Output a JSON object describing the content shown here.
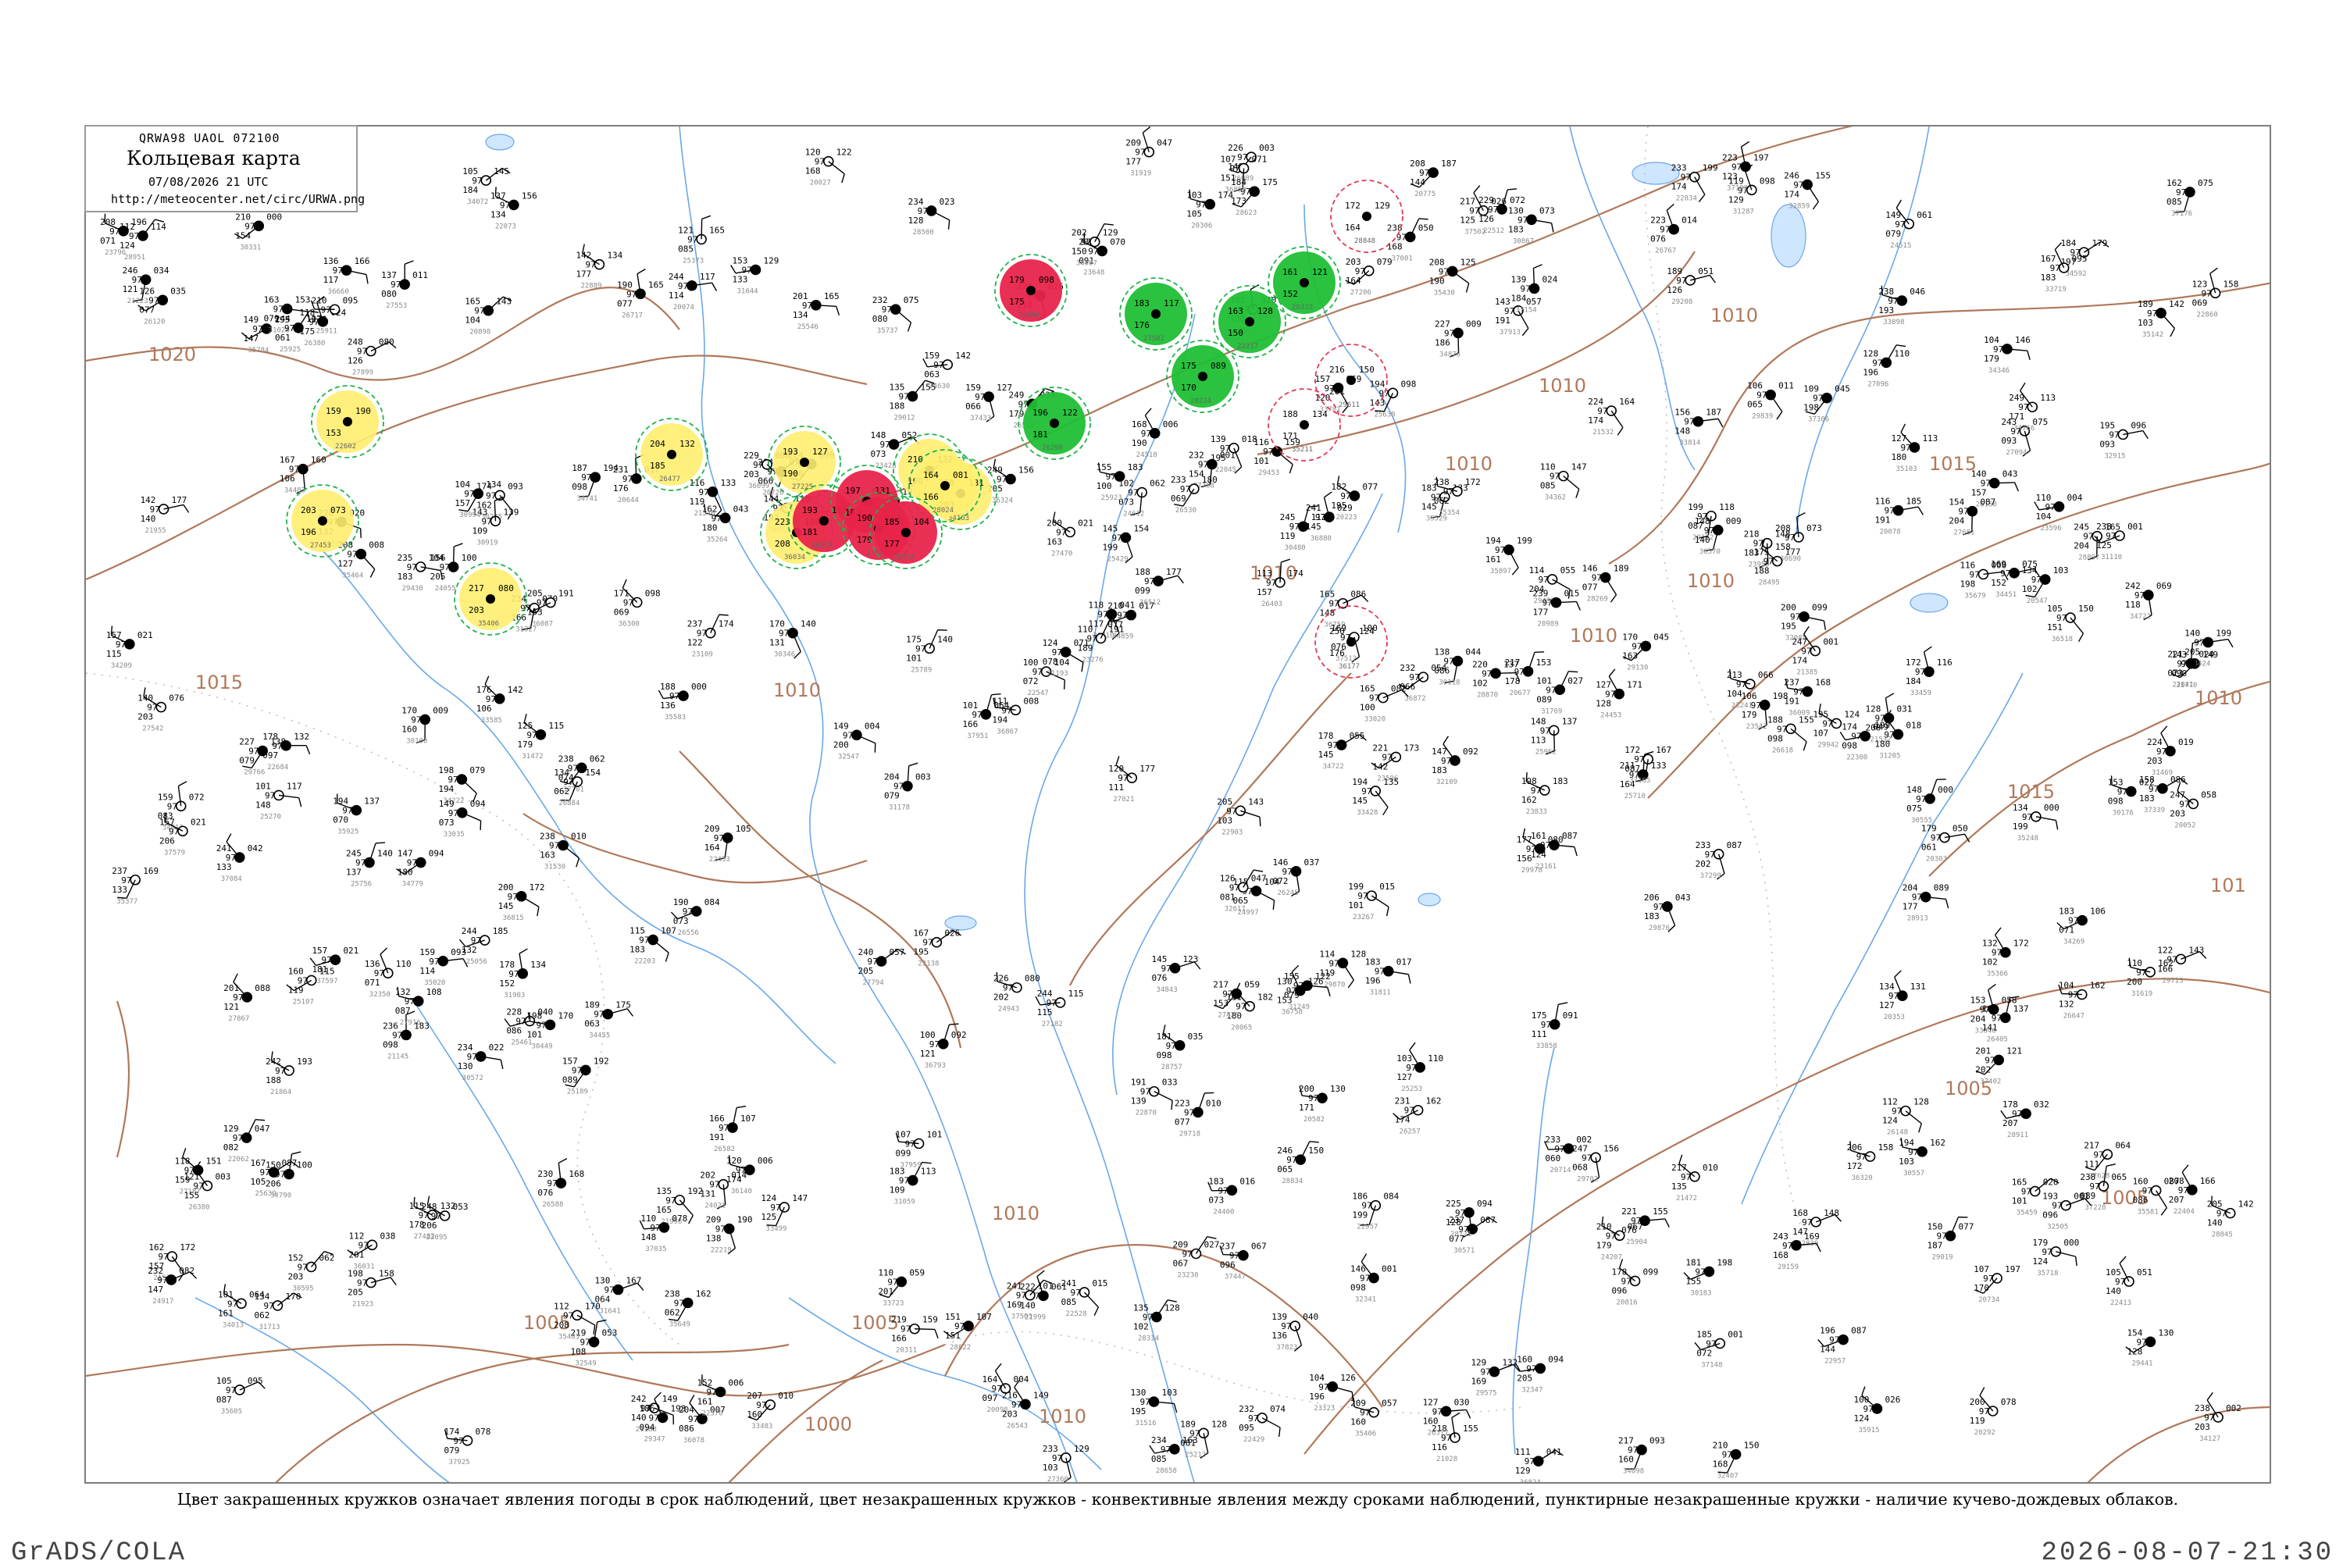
{
  "header": {
    "code": "QRWA98  UAOL  072100",
    "title": "Кольцевая карта",
    "date": "07/08/2026 21 UTC",
    "url": "http://meteocenter.net/circ/URWA.png"
  },
  "caption": "Цвет закрашенных кружков означает явления погоды в срок наблюдений, цвет незакрашенных кружков - конвективные явления между сроками наблюдений, пунктирные незакрашенные кружки - наличие кучево-дождевых облаков.",
  "footer": {
    "left": "GrADS/COLA",
    "right": "2026-08-07-21:30"
  },
  "colors": {
    "isobar": "#b0785a",
    "river": "#6aa8e8",
    "thunderstorm": "#e8244a",
    "shower": "#1fbf34",
    "drizzle_fog": "#ffee70",
    "cb_ring": "#21b34a",
    "convective_ring": "#e23a55"
  },
  "isobar_labels": [
    "1020",
    "1015",
    "1010",
    "1010",
    "1010",
    "1010",
    "1010",
    "1010",
    "1010",
    "1015",
    "1015",
    "1010",
    "1005",
    "1005",
    "1005",
    "1000",
    "1010",
    "1010",
    "1005",
    "101"
  ],
  "stations": [
    {
      "id": "22602",
      "t": "159",
      "p": "190",
      "d": "153",
      "fill": "drizzle_fog"
    },
    {
      "id": "26477",
      "t": "204",
      "p": "132",
      "d": "185",
      "fill": "drizzle_fog"
    },
    {
      "id": "27225",
      "t": "193",
      "p": "127",
      "d": "190",
      "fill": "drizzle_fog"
    },
    {
      "id": "27612",
      "t": "210",
      "p": "132",
      "d": "190",
      "fill": "drizzle_fog"
    },
    {
      "id": "34163",
      "t": "220",
      "p": "131",
      "d": "203",
      "fill": "drizzle_fog"
    },
    {
      "id": "28024",
      "t": "164",
      "p": "081",
      "d": "166",
      "fill": "drizzle_fog"
    },
    {
      "id": "27453",
      "t": "203",
      "p": "073",
      "d": "196",
      "fill": "drizzle_fog"
    },
    {
      "id": "35406",
      "t": "217",
      "p": "080",
      "d": "203",
      "fill": "drizzle_fog"
    },
    {
      "id": "36034",
      "t": "223",
      "p": "109",
      "d": "208",
      "fill": "drizzle_fog"
    },
    {
      "id": "26850",
      "t": "193",
      "p": "113",
      "d": "181",
      "fill": "thunderstorm"
    },
    {
      "id": "27786",
      "t": "197",
      "p": "131",
      "d": "183",
      "fill": "thunderstorm"
    },
    {
      "id": "28500",
      "t": "190",
      "p": "115",
      "d": "179",
      "fill": "thunderstorm"
    },
    {
      "id": "25910",
      "t": "185",
      "p": "104",
      "d": "177",
      "fill": "thunderstorm"
    },
    {
      "id": "26094",
      "t": "179",
      "p": "098",
      "d": "175",
      "fill": "thunderstorm"
    },
    {
      "id": "26298",
      "t": "196",
      "p": "122",
      "d": "181",
      "fill": "shower"
    },
    {
      "id": "27502",
      "t": "183",
      "p": "117",
      "d": "176",
      "fill": "shower"
    },
    {
      "id": "28224",
      "t": "175",
      "p": "089",
      "d": "170",
      "fill": "shower"
    },
    {
      "id": "22217",
      "t": "163",
      "p": "128",
      "d": "150",
      "fill": "shower"
    },
    {
      "id": "28333",
      "t": "161",
      "p": "121",
      "d": "152",
      "fill": "shower"
    },
    {
      "id": "28848",
      "t": "172",
      "p": "129",
      "d": "164",
      "fill": "none"
    },
    {
      "id": "29611",
      "t": "216",
      "p": "150",
      "d": "201",
      "fill": "none"
    },
    {
      "id": "35211",
      "t": "188",
      "p": "134",
      "d": "171",
      "fill": "none"
    },
    {
      "id": "36177",
      "t": "250",
      "p": "124",
      "d": "176",
      "fill": "none"
    }
  ]
}
